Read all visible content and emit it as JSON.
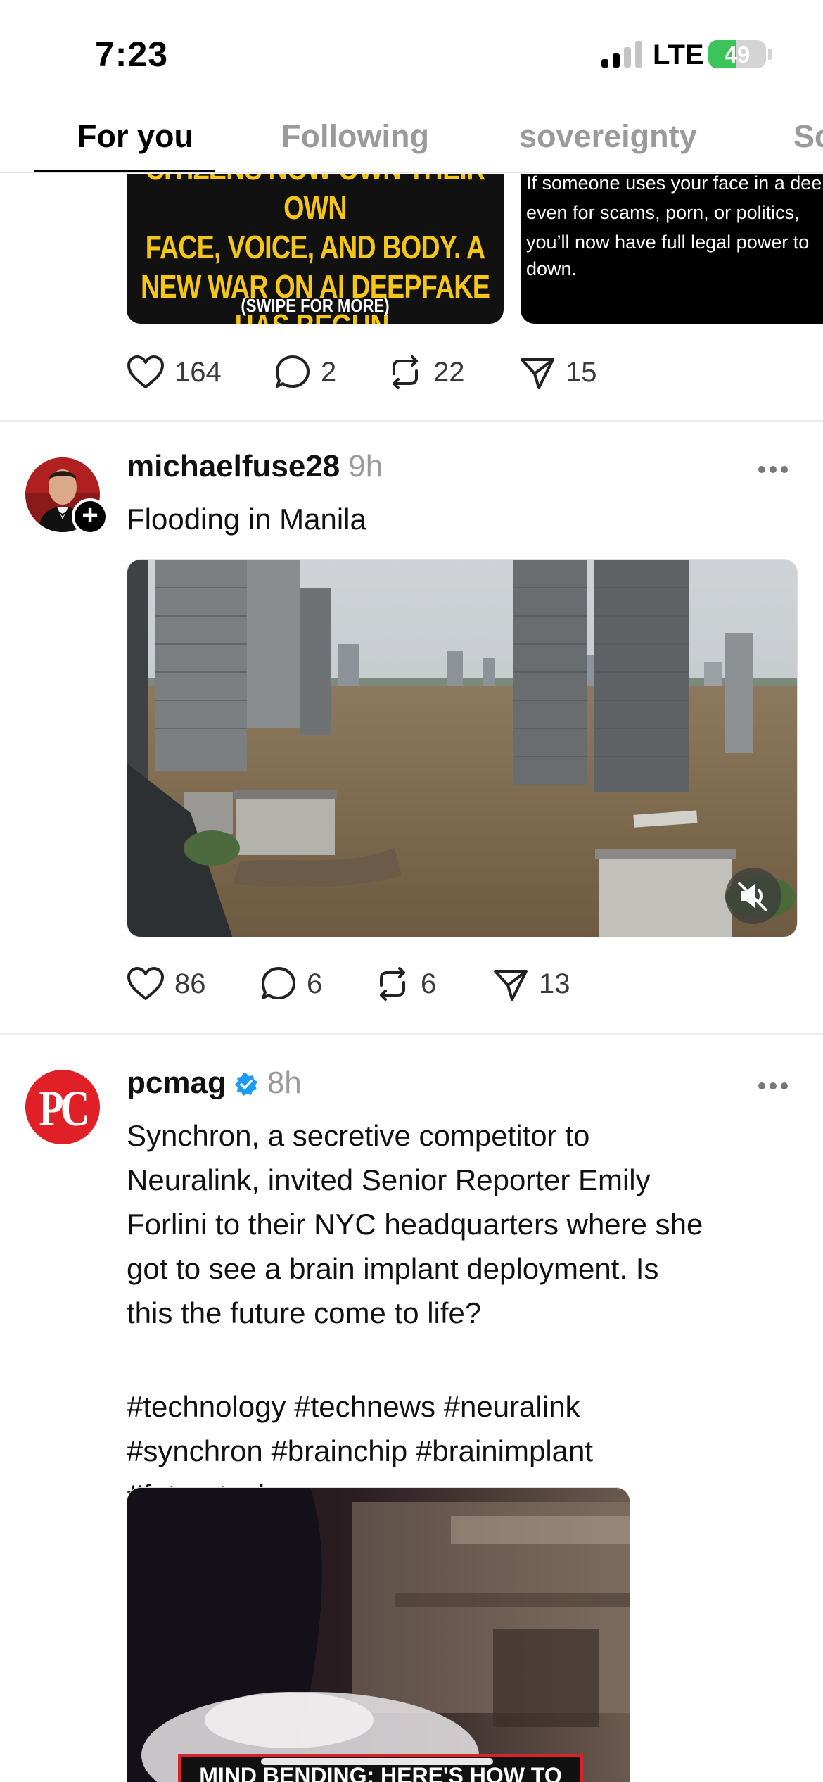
{
  "status_bar": {
    "time": "7:23",
    "network": "LTE",
    "battery": "49",
    "battery_level": 0.49
  },
  "tabs": [
    {
      "label": "For you",
      "active": true
    },
    {
      "label": "Following",
      "active": false
    },
    {
      "label": "sovereignty",
      "active": false
    },
    {
      "label": "Sc",
      "active": false
    }
  ],
  "posts": [
    {
      "carousel": {
        "card1_lines": [
          "CITIZENS NOW OWN THEIR OWN",
          "FACE, VOICE, AND BODY. A",
          "NEW WAR ON AI DEEPFAKE",
          "HAS BEGUN."
        ],
        "card1_footer": "(SWIPE FOR MORE)",
        "card2_lines": [
          "If someone uses your face in a deep",
          "even for scams, porn, or politics,",
          "you’ll now have full legal power to",
          "down."
        ]
      },
      "actions": {
        "likes": "164",
        "replies": "2",
        "reposts": "22",
        "shares": "15"
      }
    },
    {
      "username": "michaelfuse28",
      "time": "9h",
      "text": "Flooding in Manila",
      "actions": {
        "likes": "86",
        "replies": "6",
        "reposts": "6",
        "shares": "13"
      }
    },
    {
      "username": "pcmag",
      "verified": true,
      "time": "8h",
      "avatar_text": "PC",
      "text_lines": [
        "Synchron, a secretive competitor to",
        "Neuralink, invited Senior Reporter Emily",
        "Forlini to their NYC headquarters where she",
        "got to see a brain implant deployment. Is",
        "this the future come to life?"
      ],
      "hashtag_lines": [
        "#technology #technews #neuralink",
        "#synchron #brainchip #brainimplant",
        "#futuretech"
      ],
      "media_caption": "MIND BENDING: HERE'S HOW TO"
    }
  ],
  "colors": {
    "accent_verified": "#1d9bf0",
    "battery_green": "#3ac45a",
    "pcmag_red": "#e01f26",
    "deepfake_yellow": "#f5c518"
  }
}
